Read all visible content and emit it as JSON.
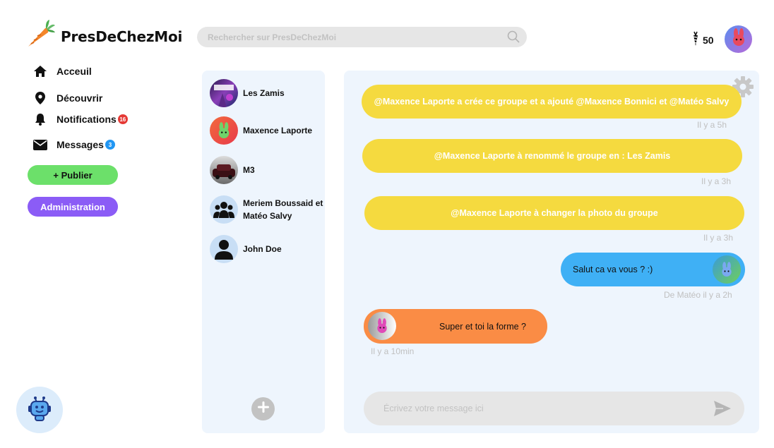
{
  "app": {
    "name": "PresDeChezMoi",
    "logo_icon": "carrot-icon"
  },
  "search": {
    "placeholder": "Rechercher sur PresDeChezMoi",
    "icon": "search-icon"
  },
  "header": {
    "coins": "50",
    "coin_icon": "carrot-coin-icon"
  },
  "sidebar": {
    "items": [
      {
        "label": "Acceuil",
        "icon": "home-icon"
      },
      {
        "label": "Découvrir",
        "icon": "location-pin-icon"
      },
      {
        "label": "Notifications",
        "icon": "bell-icon",
        "badge": "16",
        "badge_color": "#e53935"
      },
      {
        "label": "Messages",
        "icon": "envelope-icon",
        "badge": "3",
        "badge_color": "#2196f3"
      }
    ],
    "publish_label": "+ Publier",
    "admin_label": "Administration"
  },
  "conversations": [
    {
      "name": "Les Zamis"
    },
    {
      "name": "Maxence Laporte"
    },
    {
      "name": "M3"
    },
    {
      "name": "Meriem Boussaid et Matéo Salvy"
    },
    {
      "name": "John Doe"
    }
  ],
  "chat": {
    "system_messages": [
      {
        "text": "@Maxence Laporte a crée ce groupe et a ajouté @Maxence Bonnici et @Matéo Salvy",
        "time": "Il y a 5h"
      },
      {
        "text": "@Maxence Laporte à renommé le groupe en : Les Zamis",
        "time": "Il y a 3h"
      },
      {
        "text": "@Maxence Laporte à changer la photo du groupe",
        "time": "Il y a 3h"
      }
    ],
    "messages": [
      {
        "text": "Salut ca va vous ? :)",
        "time": "De Matéo il y a 2h",
        "side": "right",
        "color": "#3fb0f5"
      },
      {
        "text": "Super et toi la forme ?",
        "time": "Il y a 10min",
        "side": "left",
        "color": "#fa8c45"
      }
    ],
    "composer_placeholder": "Écrivez votre message ici"
  },
  "colors": {
    "accent_yellow": "#f5da3f",
    "accent_blue": "#3fb0f5",
    "accent_orange": "#fa8c45",
    "publish_green": "#6ce06a",
    "admin_purple": "#8b5cf6",
    "panel_bg": "#eef5fd"
  }
}
